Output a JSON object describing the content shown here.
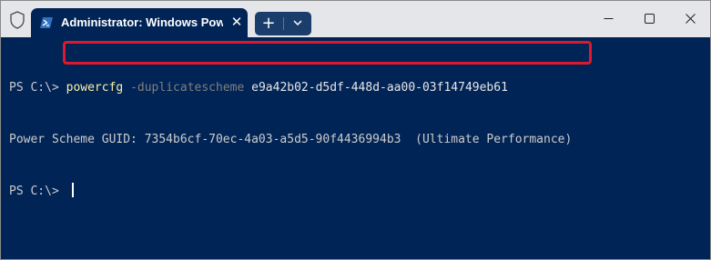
{
  "window": {
    "tab_title": "Administrator: Windows PowerShell",
    "tab_icon": "powershell-icon",
    "tab_close_glyph": "✕",
    "new_tab_glyph": "+",
    "colors": {
      "background": "#012456",
      "titlebar": "#e4e6ea",
      "highlight": "#e0182d",
      "command": "#f9f1a5",
      "parameter": "#7f7f7f",
      "text": "#cccccc"
    }
  },
  "terminal": {
    "line1": {
      "prompt": "PS C:\\> ",
      "command": "powercfg",
      "parameter": " -duplicatescheme",
      "argument": " e9a42b02-d5df-448d-aa00-03f14749eb61"
    },
    "line2": "Power Scheme GUID: 7354b6cf-70ec-4a03-a5d5-90f4436994b3  (Ultimate Performance)",
    "line3": {
      "prompt": "PS C:\\> "
    }
  }
}
